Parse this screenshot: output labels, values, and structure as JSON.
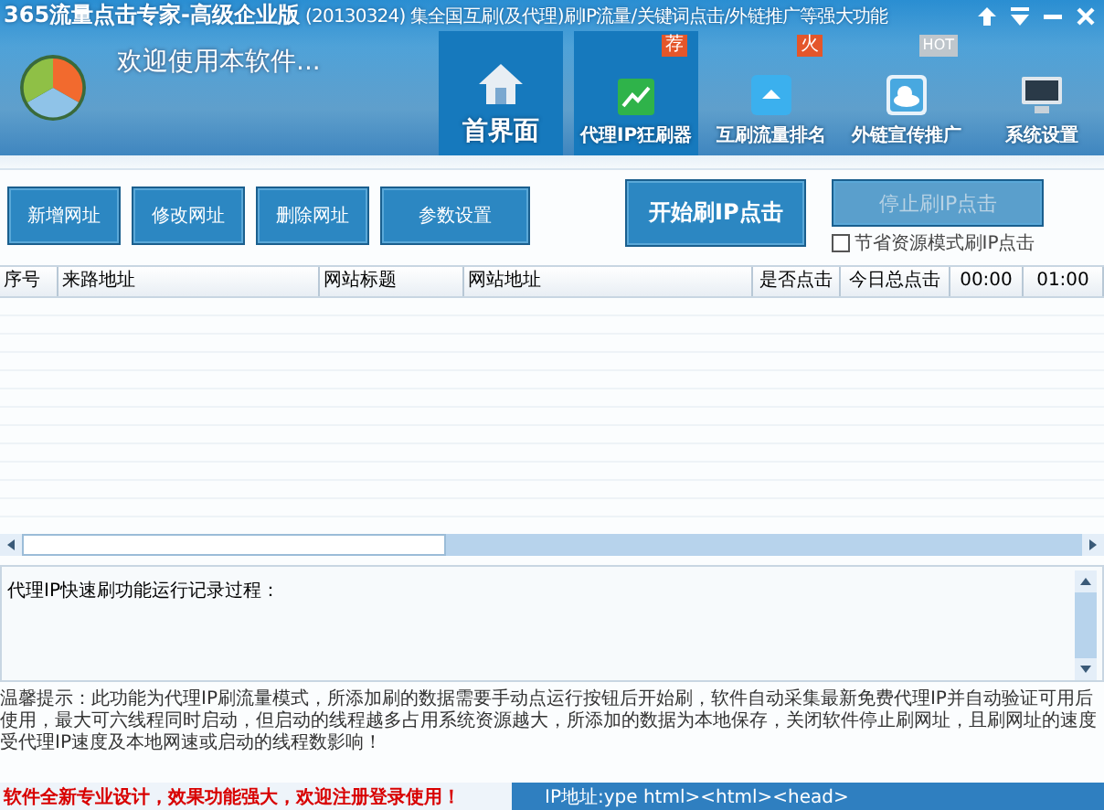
{
  "window": {
    "title": "365流量点击专家-高级企业版",
    "subtitle": "(20130324) 集全国互刷(及代理)刷IP流量/关键词点击/外链推广等强大功能"
  },
  "welcome": "欢迎使用本软件...",
  "nav": [
    {
      "label": "首界面",
      "selected": true,
      "kind": "house"
    },
    {
      "label": "代理IP狂刷器",
      "selected": true,
      "kind": "chart",
      "badge": "荐"
    },
    {
      "label": "互刷流量排名",
      "selected": false,
      "kind": "up",
      "badge": "火"
    },
    {
      "label": "外链宣传推广",
      "selected": false,
      "kind": "cloud",
      "badge": "HOT"
    },
    {
      "label": "系统设置",
      "selected": false,
      "kind": "monitor"
    }
  ],
  "toolbar": {
    "buttons": [
      "新增网址",
      "修改网址",
      "删除网址",
      "参数设置"
    ],
    "start_button": {
      "label": "开始刷IP点击",
      "disabled": false
    },
    "stop_button": {
      "label": "停止刷IP点击",
      "disabled": true
    },
    "save_mode": {
      "label": "节省资源模式刷IP点击",
      "checked": false
    }
  },
  "table": {
    "columns": [
      "序号",
      "来路地址",
      "网站标题",
      "网站地址",
      "是否点击",
      "今日总点击",
      "00:00",
      "01:00"
    ]
  },
  "log": {
    "text": "代理IP快速刷功能运行记录过程："
  },
  "tip": "温馨提示：此功能为代理IP刷流量模式，所添加刷的数据需要手动点运行按钮后开始刷，软件自动采集最新免费代理IP并自动验证可用后使用，最大可六线程同时启动，但启动的线程越多占用系统资源越大，所添加的数据为本地保存，关闭软件停止刷网址，且刷网址的速度受代理IP速度及本地网速或启动的线程数影响！",
  "status_bar": {
    "message": "软件全新专业设计，效果功能强大，欢迎注册登录使用！",
    "ip": "IP地址:ype html><html><head>"
  }
}
